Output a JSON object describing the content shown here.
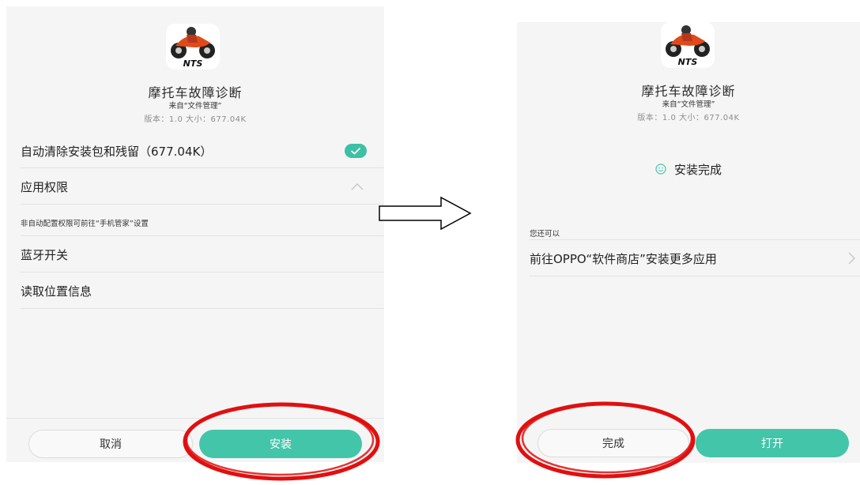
{
  "left_screen": {
    "app": {
      "name": "摩托车故障诊断",
      "source": "来自“文件管理”",
      "version_line": "版本：1.0  大小：677.04K",
      "icon": "motorcycle-nts-icon"
    },
    "auto_clean_label": "自动清除安装包和残留（677.04K）",
    "auto_clean_checked": true,
    "permissions_label": "应用权限",
    "permissions_note": "非自动配置权限可前往“手机管家”设置",
    "permission_items": [
      "蓝牙开关",
      "读取位置信息"
    ],
    "cancel_label": "取消",
    "install_label": "安装"
  },
  "right_screen": {
    "app": {
      "name": "摩托车故障诊断",
      "source": "来自“文件管理”",
      "version_line": "版本：1.0  大小：677.04K",
      "icon": "motorcycle-nts-icon"
    },
    "install_complete_label": "安装完成",
    "you_can_label": "您还可以",
    "store_link_label": "前往OPPO“软件商店”安装更多应用",
    "done_label": "完成",
    "open_label": "打开"
  },
  "colors": {
    "accent": "#43c5aa",
    "annotation": "#e01010",
    "panel_bg": "#f5f5f5"
  }
}
